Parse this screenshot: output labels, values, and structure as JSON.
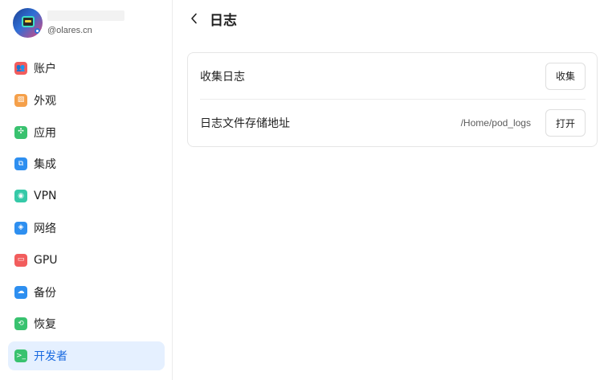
{
  "profile": {
    "domain": "@olares.cn"
  },
  "sidebar": {
    "items": [
      {
        "label": "账户",
        "icon": "account-icon",
        "color": "#f25d5d",
        "glyph": "👥"
      },
      {
        "label": "外观",
        "icon": "appearance-icon",
        "color": "#f5a04a",
        "glyph": "▨"
      },
      {
        "label": "应用",
        "icon": "apps-icon",
        "color": "#39c26f",
        "glyph": "✣"
      },
      {
        "label": "集成",
        "icon": "integration-icon",
        "color": "#2e8ff0",
        "glyph": "⧉"
      },
      {
        "label": "VPN",
        "icon": "vpn-icon",
        "color": "#36c9a8",
        "glyph": "◉"
      },
      {
        "label": "网络",
        "icon": "network-icon",
        "color": "#2e8ff0",
        "glyph": "◈"
      },
      {
        "label": "GPU",
        "icon": "gpu-icon",
        "color": "#f25d5d",
        "glyph": "▭"
      },
      {
        "label": "备份",
        "icon": "backup-icon",
        "color": "#2e8ff0",
        "glyph": "☁"
      },
      {
        "label": "恢复",
        "icon": "restore-icon",
        "color": "#39c26f",
        "glyph": "⟲"
      },
      {
        "label": "开发者",
        "icon": "developer-icon",
        "color": "#39c26f",
        "glyph": ">_",
        "active": true
      }
    ]
  },
  "header": {
    "title": "日志"
  },
  "card": {
    "collect": {
      "label": "收集日志",
      "button": "收集"
    },
    "storage": {
      "label": "日志文件存储地址",
      "path": "/Home/pod_logs",
      "button": "打开"
    }
  },
  "colors": {
    "accent": "#1a6ae0",
    "active_bg": "#e5f0ff"
  }
}
